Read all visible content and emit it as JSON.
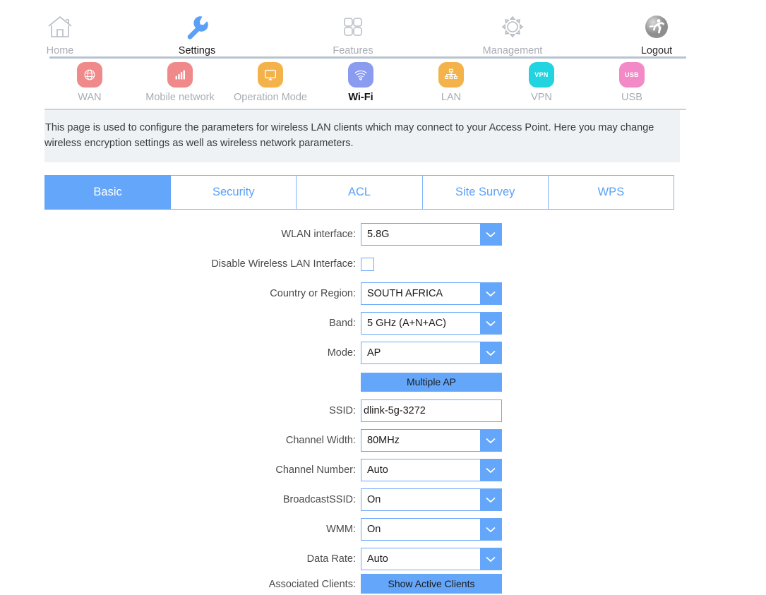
{
  "topnav": {
    "items": [
      {
        "label": "Home",
        "icon": "home-icon",
        "active": false
      },
      {
        "label": "Settings",
        "icon": "wrench-icon",
        "active": true
      },
      {
        "label": "Features",
        "icon": "grid-icon",
        "active": false
      },
      {
        "label": "Management",
        "icon": "gear-icon",
        "active": false
      },
      {
        "label": "Logout",
        "icon": "logout-runner-icon",
        "active": false
      }
    ]
  },
  "subnav": {
    "items": [
      {
        "label": "WAN",
        "icon": "globe-icon",
        "color": "#f08a8a",
        "glyph": "",
        "active": false
      },
      {
        "label": "Mobile network",
        "icon": "signal-bars-icon",
        "color": "#f08a8a",
        "glyph": "",
        "active": false
      },
      {
        "label": "Operation Mode",
        "icon": "monitor-icon",
        "color": "#f4b34a",
        "glyph": "",
        "active": false
      },
      {
        "label": "Wi-Fi",
        "icon": "wifi-icon",
        "color": "#8a9bf0",
        "glyph": "",
        "active": true
      },
      {
        "label": "LAN",
        "icon": "network-tree-icon",
        "color": "#f4b34a",
        "glyph": "",
        "active": false
      },
      {
        "label": "VPN",
        "icon": "vpn-icon",
        "color": "#22d3e0",
        "glyph": "VPN",
        "active": false
      },
      {
        "label": "USB",
        "icon": "usb-icon",
        "color": "#f489c8",
        "glyph": "USB",
        "active": false
      }
    ]
  },
  "description": {
    "line1": "This page is used to configure the parameters for wireless LAN clients which may connect to your Access Point. Here you may change",
    "line2": "wireless encryption settings as well as wireless network parameters."
  },
  "tabs": [
    {
      "label": "Basic",
      "active": true
    },
    {
      "label": "Security",
      "active": false
    },
    {
      "label": "ACL",
      "active": false
    },
    {
      "label": "Site Survey",
      "active": false
    },
    {
      "label": "WPS",
      "active": false
    }
  ],
  "form": {
    "wlan_interface": {
      "label": "WLAN interface:",
      "value": "5.8G"
    },
    "disable_wireless": {
      "label": "Disable Wireless LAN Interface:",
      "checked": false
    },
    "country": {
      "label": "Country or Region:",
      "value": "SOUTH AFRICA"
    },
    "band": {
      "label": "Band:",
      "value": "5 GHz (A+N+AC)"
    },
    "mode": {
      "label": "Mode:",
      "value": "AP"
    },
    "multiple_ap": {
      "label": "Multiple AP"
    },
    "ssid": {
      "label": "SSID:",
      "value": "dlink-5g-3272"
    },
    "channel_width": {
      "label": "Channel Width:",
      "value": "80MHz"
    },
    "channel_number": {
      "label": "Channel Number:",
      "value": "Auto"
    },
    "broadcast_ssid": {
      "label": "BroadcastSSID:",
      "value": "On"
    },
    "wmm": {
      "label": "WMM:",
      "value": "On"
    },
    "data_rate": {
      "label": "Data Rate:",
      "value": "Auto"
    },
    "associated_clients": {
      "label": "Associated Clients:",
      "button": "Show Active Clients"
    }
  },
  "colors": {
    "accent_blue": "#64a6fa",
    "panel_bg": "#eef2f5",
    "muted_text": "#a8acb3"
  }
}
